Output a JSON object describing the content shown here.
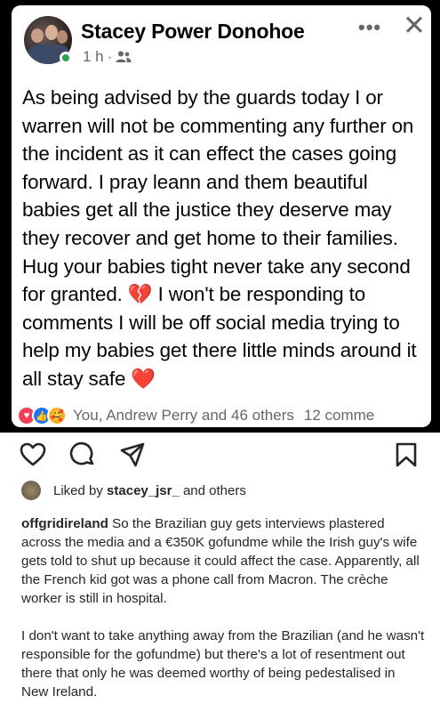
{
  "post": {
    "author": "Stacey Power Donohoe",
    "time": "1 h",
    "audience_icon": "friends-icon",
    "more_label": "•••",
    "close_label": "✕",
    "body": "As being advised by the guards today I or warren will not be commenting any further on the incident as it can effect the cases going forward. I pray leann and them beautiful babies get all the justice they deserve may they recover and get home to their families. Hug your babies tight never take any second for granted. 💔 I won't be responding to comments I will be off social media trying to help my babies get there little minds around it all stay safe ❤️",
    "reactions_text": "You, Andrew Perry and 46 others",
    "comments_text": "12 comme"
  },
  "instagram": {
    "liked_by_prefix": "Liked by ",
    "liked_by_user": "stacey_jsr_",
    "liked_by_suffix": " and others",
    "username": "offgridireland",
    "caption_1": " So the Brazilian guy gets interviews plastered across the media and a €350K gofundme while the Irish guy's wife gets told to shut up because it could affect the case. Apparently, all the French kid got was a phone call from Macron. The crèche worker is still in hospital.",
    "caption_2": "I don't want to take anything away from the Brazilian (and he wasn't responsible for the gofundme) but there's a lot of resentment out there that only he was deemed worthy of being pedestalised in New Ireland."
  },
  "colors": {
    "online": "#31a24c",
    "love": "#f33e58",
    "like": "#1877f2",
    "care": "#f7b125",
    "muted": "#65676b"
  }
}
